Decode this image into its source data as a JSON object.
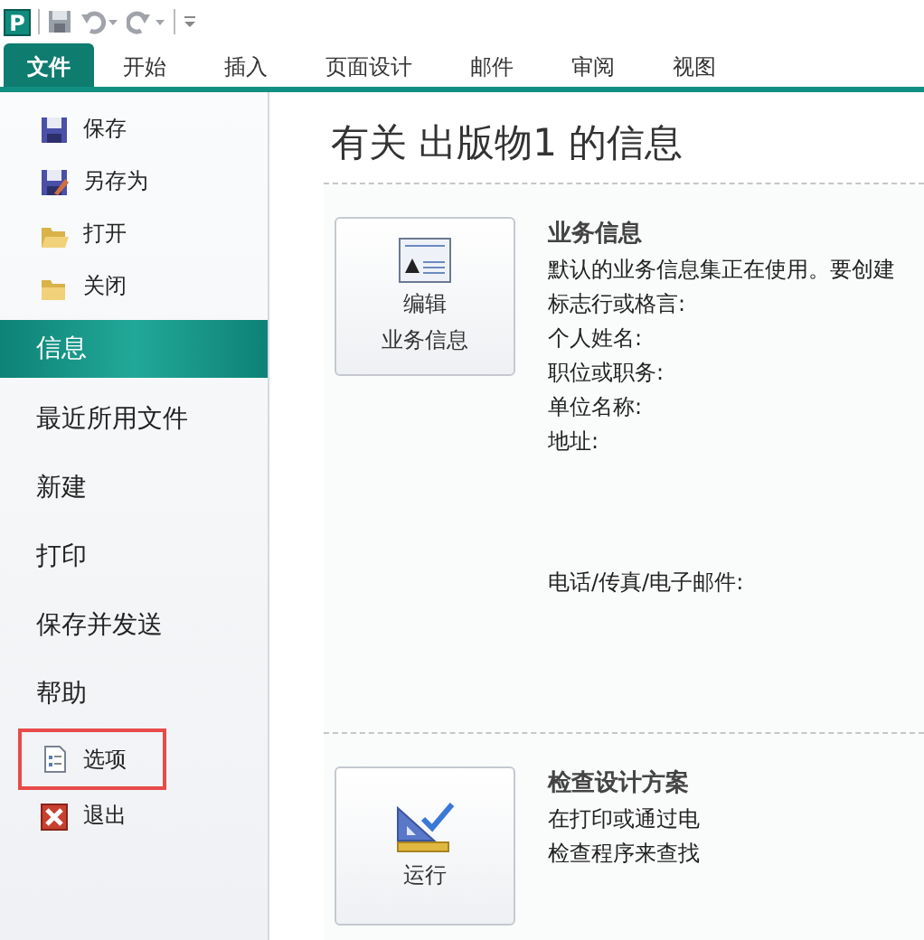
{
  "quick_access": {
    "app_letter": "P"
  },
  "tabs": [
    {
      "label": "文件",
      "selected": true
    },
    {
      "label": "开始",
      "selected": false
    },
    {
      "label": "插入",
      "selected": false
    },
    {
      "label": "页面设计",
      "selected": false
    },
    {
      "label": "邮件",
      "selected": false
    },
    {
      "label": "审阅",
      "selected": false
    },
    {
      "label": "视图",
      "selected": false
    }
  ],
  "sidebar": {
    "items": [
      {
        "label": "保存",
        "kind": "command",
        "selected": false,
        "highlighted": false
      },
      {
        "label": "另存为",
        "kind": "command",
        "selected": false,
        "highlighted": false
      },
      {
        "label": "打开",
        "kind": "command",
        "selected": false,
        "highlighted": false
      },
      {
        "label": "关闭",
        "kind": "command",
        "selected": false,
        "highlighted": false
      },
      {
        "label": "信息",
        "kind": "page",
        "selected": true,
        "highlighted": false
      },
      {
        "label": "最近所用文件",
        "kind": "page",
        "selected": false,
        "highlighted": false
      },
      {
        "label": "新建",
        "kind": "page",
        "selected": false,
        "highlighted": false
      },
      {
        "label": "打印",
        "kind": "page",
        "selected": false,
        "highlighted": false
      },
      {
        "label": "保存并发送",
        "kind": "page",
        "selected": false,
        "highlighted": false
      },
      {
        "label": "帮助",
        "kind": "page",
        "selected": false,
        "highlighted": false
      },
      {
        "label": "选项",
        "kind": "command",
        "selected": false,
        "highlighted": true
      },
      {
        "label": "退出",
        "kind": "command",
        "selected": false,
        "highlighted": false
      }
    ]
  },
  "content": {
    "title": "有关 出版物1 的信息",
    "sections": [
      {
        "button": [
          "编辑",
          "业务信息"
        ],
        "heading": "业务信息",
        "lines": [
          {
            "text": "默认的业务信息集正在使用。要创建",
            "kind": "line"
          },
          {
            "text": "标志行或格言:",
            "kind": "line"
          },
          {
            "text": "个人姓名:",
            "kind": "line"
          },
          {
            "text": "职位或职务:",
            "kind": "line"
          },
          {
            "text": "单位名称:",
            "kind": "line"
          },
          {
            "text": "地址:",
            "kind": "multiline"
          },
          {
            "text": "电话/传真/电子邮件:",
            "kind": "multiline"
          }
        ]
      },
      {
        "button": [
          "运行"
        ],
        "heading": "检查设计方案",
        "lines": [
          {
            "text": "在打印或通过电",
            "kind": "line"
          },
          {
            "text": "检查程序来查找",
            "kind": "line"
          }
        ]
      }
    ]
  }
}
